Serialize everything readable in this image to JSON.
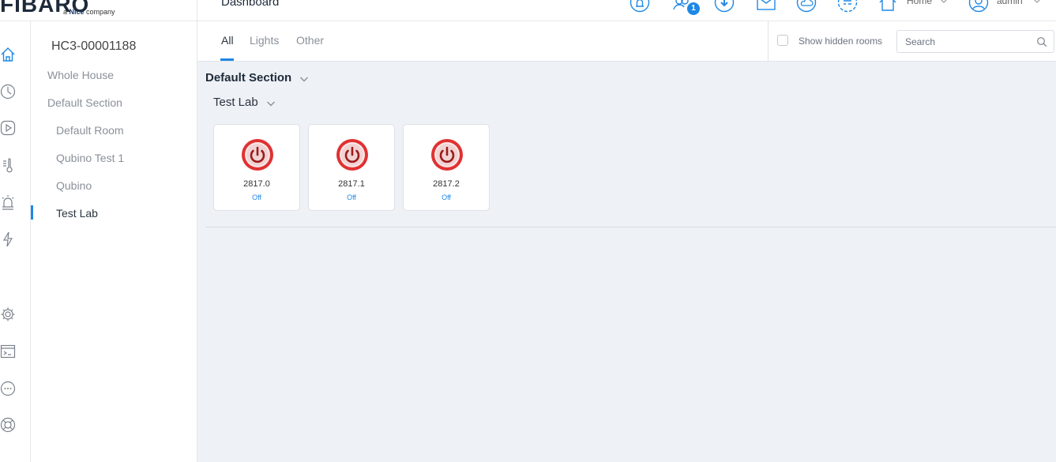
{
  "header": {
    "logo": {
      "word": "FIBARO",
      "tag_prefix": "a ",
      "tag_brand": "Nice",
      "tag_suffix": " company"
    },
    "title": "Dashboard",
    "notification_count": "1",
    "home_select": "Home",
    "user_select": "admin"
  },
  "sidebar": {
    "controller_name": "HC3-00001188",
    "items": [
      {
        "label": "Whole House"
      },
      {
        "label": "Default Section"
      },
      {
        "label": "Default Room"
      },
      {
        "label": "Qubino Test 1"
      },
      {
        "label": "Qubino"
      },
      {
        "label": "Test Lab"
      }
    ]
  },
  "tabs": [
    {
      "label": "All"
    },
    {
      "label": "Lights"
    },
    {
      "label": "Other"
    }
  ],
  "filters": {
    "show_hidden_label": "Show hidden rooms",
    "search_placeholder": "Search"
  },
  "content": {
    "section_name": "Default Section",
    "room_name": "Test Lab",
    "devices": [
      {
        "name": "2817.0",
        "state": "Off"
      },
      {
        "name": "2817.1",
        "state": "Off"
      },
      {
        "name": "2817.2",
        "state": "Off"
      }
    ]
  },
  "colors": {
    "accent": "#1e88e5",
    "power_off": "#d62828",
    "background": "#eef1f5"
  }
}
